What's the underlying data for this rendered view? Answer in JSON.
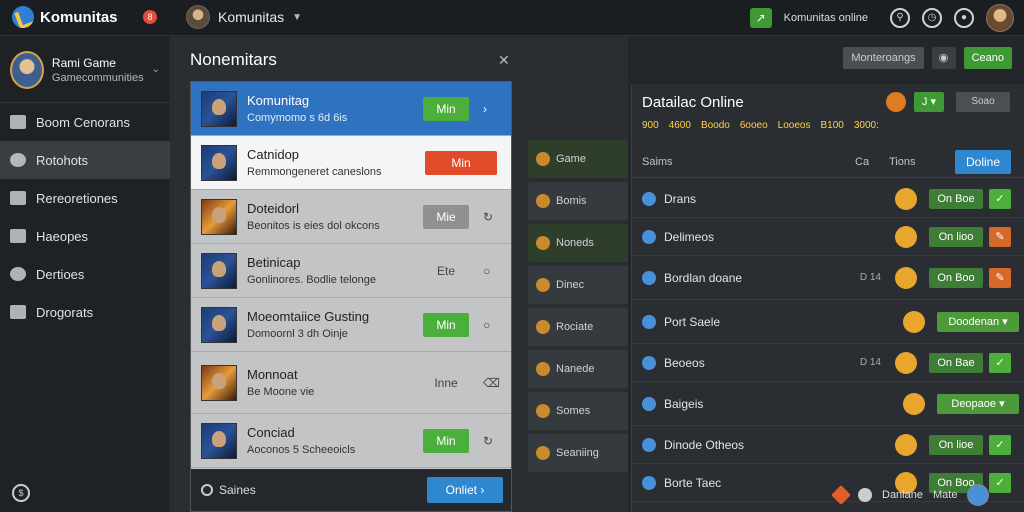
{
  "topbar": {
    "app_name": "Komunitas",
    "notif_count": "8",
    "switcher_label": "Komunitas",
    "status_text": "Komunitas online"
  },
  "sidebar": {
    "profile_name": "Rami Game",
    "profile_sub": "Gamecommunities",
    "items": [
      {
        "label": "Boom Cenorans"
      },
      {
        "label": "Rotohots"
      },
      {
        "label": "Rereoretiones"
      },
      {
        "label": "Haeopes"
      },
      {
        "label": "Dertioes"
      },
      {
        "label": "Drogorats"
      }
    ]
  },
  "middle": {
    "side_items": [
      {
        "label": "Game"
      },
      {
        "label": "Bomis"
      },
      {
        "label": "Noneds"
      },
      {
        "label": "Dinec"
      },
      {
        "label": "Rociate"
      },
      {
        "label": "Nanede"
      },
      {
        "label": "Somes"
      },
      {
        "label": "Seaniing"
      }
    ]
  },
  "modal": {
    "title": "Nonemitars",
    "rows": [
      {
        "title": "Komunitag",
        "subtitle": "Comymomo s 6d 6is",
        "action": "Min"
      },
      {
        "title": "Catnidop",
        "subtitle": "Remmongeneret caneslons",
        "action": "Min"
      },
      {
        "title": "Doteidorl",
        "subtitle": "Beonitos is eies dol okcons",
        "action": "Mie"
      },
      {
        "title": "Betinicap",
        "subtitle": "Gonlinores. Bodlie telonge",
        "action": "Ete"
      },
      {
        "title": "Moeomtaiice Gusting",
        "subtitle": "Domoornl 3 dh Oinje",
        "action": "Min"
      },
      {
        "title": "Monnoat",
        "subtitle": "Be Moone vie",
        "action": "Inne"
      },
      {
        "title": "Conciad",
        "subtitle": "Aoconos 5 Scheeoicls",
        "action": "Min"
      }
    ],
    "footer_label": "Saines",
    "footer_button": "Onliet"
  },
  "right": {
    "top_buttons": [
      "Monteroangs",
      "Ceano"
    ],
    "title": "Datailac Online",
    "head_button": "J",
    "head_square": "Soao",
    "stats": [
      "900",
      "4600",
      "Boodo",
      "6ooeo",
      "Looeos",
      "B100",
      "3000:"
    ],
    "col_name": "Saims",
    "col_a": "Ca",
    "col_b": "Tions",
    "col_button": "Doline",
    "rows": [
      {
        "name": "Drans",
        "mark": "",
        "status": "On Boe",
        "check": "green"
      },
      {
        "name": "Delimeos",
        "mark": "",
        "status": "On lioo",
        "check": "orange"
      },
      {
        "name": "Bordlan doane",
        "mark": "D 14",
        "status": "On Boo",
        "check": "orange"
      },
      {
        "name": "Port Saele",
        "mark": "",
        "status": "Doodenan",
        "check": ""
      },
      {
        "name": "Beoeos",
        "mark": "D 14",
        "status": "On Bae",
        "check": "green"
      },
      {
        "name": "Baigeis",
        "mark": "",
        "status": "Deopaoe",
        "check": ""
      },
      {
        "name": "Dinode Otheos",
        "mark": "",
        "status": "On lioe",
        "check": "green"
      },
      {
        "name": "Borte Taec",
        "mark": "",
        "status": "On Boo",
        "check": "green"
      }
    ]
  },
  "bottom_bar": {
    "user_name": "Danlane",
    "link": "Mate"
  }
}
